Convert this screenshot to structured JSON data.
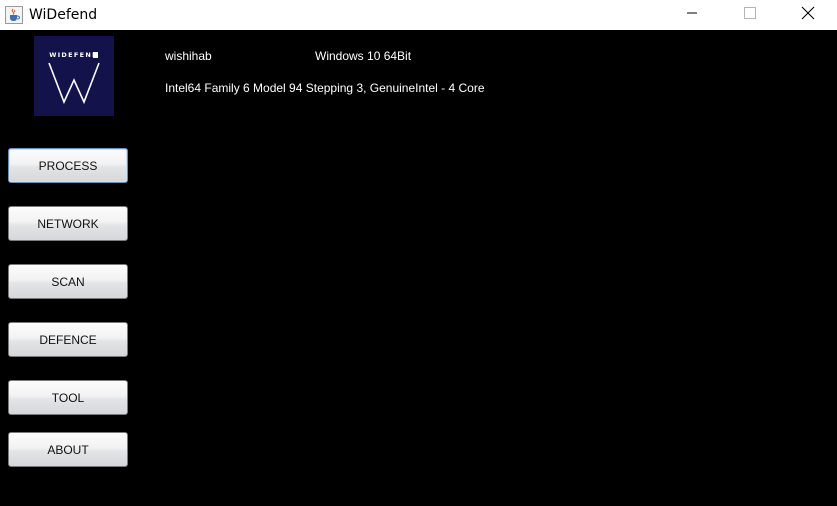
{
  "window": {
    "title": "WiDefend",
    "app_icon": "java-cup-icon",
    "controls": [
      "minimize-icon",
      "maximize-icon",
      "close-icon"
    ]
  },
  "logo": {
    "text": "WIDEFEND",
    "background": "#14124a"
  },
  "system": {
    "username": "wishihab",
    "os": "Windows 10 64Bit",
    "cpu": "Intel64 Family 6 Model 94 Stepping 3, GenuineIntel - 4 Core"
  },
  "nav": {
    "items": [
      {
        "label": "PROCESS",
        "active": true
      },
      {
        "label": "NETWORK",
        "active": false
      },
      {
        "label": "SCAN",
        "active": false
      },
      {
        "label": "DEFENCE",
        "active": false
      },
      {
        "label": "TOOL",
        "active": false
      },
      {
        "label": "ABOUT",
        "active": false
      }
    ]
  },
  "colors": {
    "background": "#000000",
    "titlebar": "#ffffff",
    "text": "#ffffff"
  }
}
